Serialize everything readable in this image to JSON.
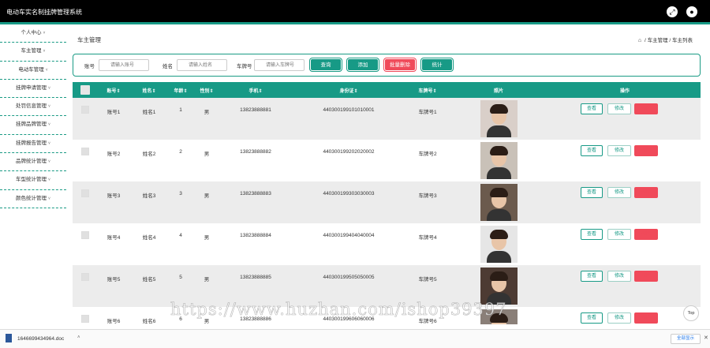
{
  "app": {
    "title": "电动车实名制挂牌管理系统"
  },
  "topbar_icons": [
    "expand-icon",
    "user-icon"
  ],
  "sidebar": {
    "items": [
      {
        "label": "个人中心"
      },
      {
        "label": "车主管理"
      },
      {
        "label": "电动车管理"
      },
      {
        "label": "挂牌申请管理"
      },
      {
        "label": "处罚信息管理"
      },
      {
        "label": "挂牌品牌管理"
      },
      {
        "label": "挂牌报告管理"
      },
      {
        "label": "品牌统计管理"
      },
      {
        "label": "车型统计管理"
      },
      {
        "label": "颜色统计管理"
      }
    ]
  },
  "page": {
    "title": "车主管理",
    "breadcrumb": {
      "parent": "车主管理",
      "current": "车主列表",
      "sep": "/"
    }
  },
  "search": {
    "account_label": "账号",
    "account_placeholder": "请输入账号",
    "name_label": "姓名",
    "name_placeholder": "请输入姓名",
    "plate_label": "车牌号",
    "plate_placeholder": "请输入车牌号",
    "query_btn": "查询",
    "add_btn": "添加",
    "batch_delete_btn": "批量删除",
    "stats_btn": "统计"
  },
  "table": {
    "headers": {
      "account": "账号⇕",
      "name": "姓名⇕",
      "age": "年龄⇕",
      "gender": "性别⇕",
      "phone": "手机⇕",
      "id_card": "身份证⇕",
      "plate": "车牌号⇕",
      "photo": "照片",
      "actions": "操作"
    },
    "row_actions": {
      "view": "查看",
      "edit": "修改",
      "delete": "删除"
    },
    "rows": [
      {
        "account": "账号1",
        "name": "姓名1",
        "age": "1",
        "gender": "男",
        "phone": "13823888881",
        "id_card": "440300199101010001",
        "plate": "车牌号1"
      },
      {
        "account": "账号2",
        "name": "姓名2",
        "age": "2",
        "gender": "男",
        "phone": "13823888882",
        "id_card": "440300199202020002",
        "plate": "车牌号2"
      },
      {
        "account": "账号3",
        "name": "姓名3",
        "age": "3",
        "gender": "男",
        "phone": "13823888883",
        "id_card": "440300199303030003",
        "plate": "车牌号3"
      },
      {
        "account": "账号4",
        "name": "姓名4",
        "age": "4",
        "gender": "男",
        "phone": "13823888884",
        "id_card": "440300199404040004",
        "plate": "车牌号4"
      },
      {
        "account": "账号5",
        "name": "姓名5",
        "age": "5",
        "gender": "男",
        "phone": "13823888885",
        "id_card": "440300199505050005",
        "plate": "车牌号5"
      },
      {
        "account": "账号6",
        "name": "姓名6",
        "age": "6",
        "gender": "男",
        "phone": "13823888886",
        "id_card": "440300199606060006",
        "plate": "车牌号6"
      }
    ]
  },
  "top_button": "Top",
  "download_bar": {
    "file_name": "1646699434964.doc",
    "show_all": "全部显示"
  },
  "watermark": "https://www.huzhan.com/ishop39397",
  "colors": {
    "accent": "#179a86",
    "danger": "#f04a5a",
    "topbar": "#000000"
  }
}
